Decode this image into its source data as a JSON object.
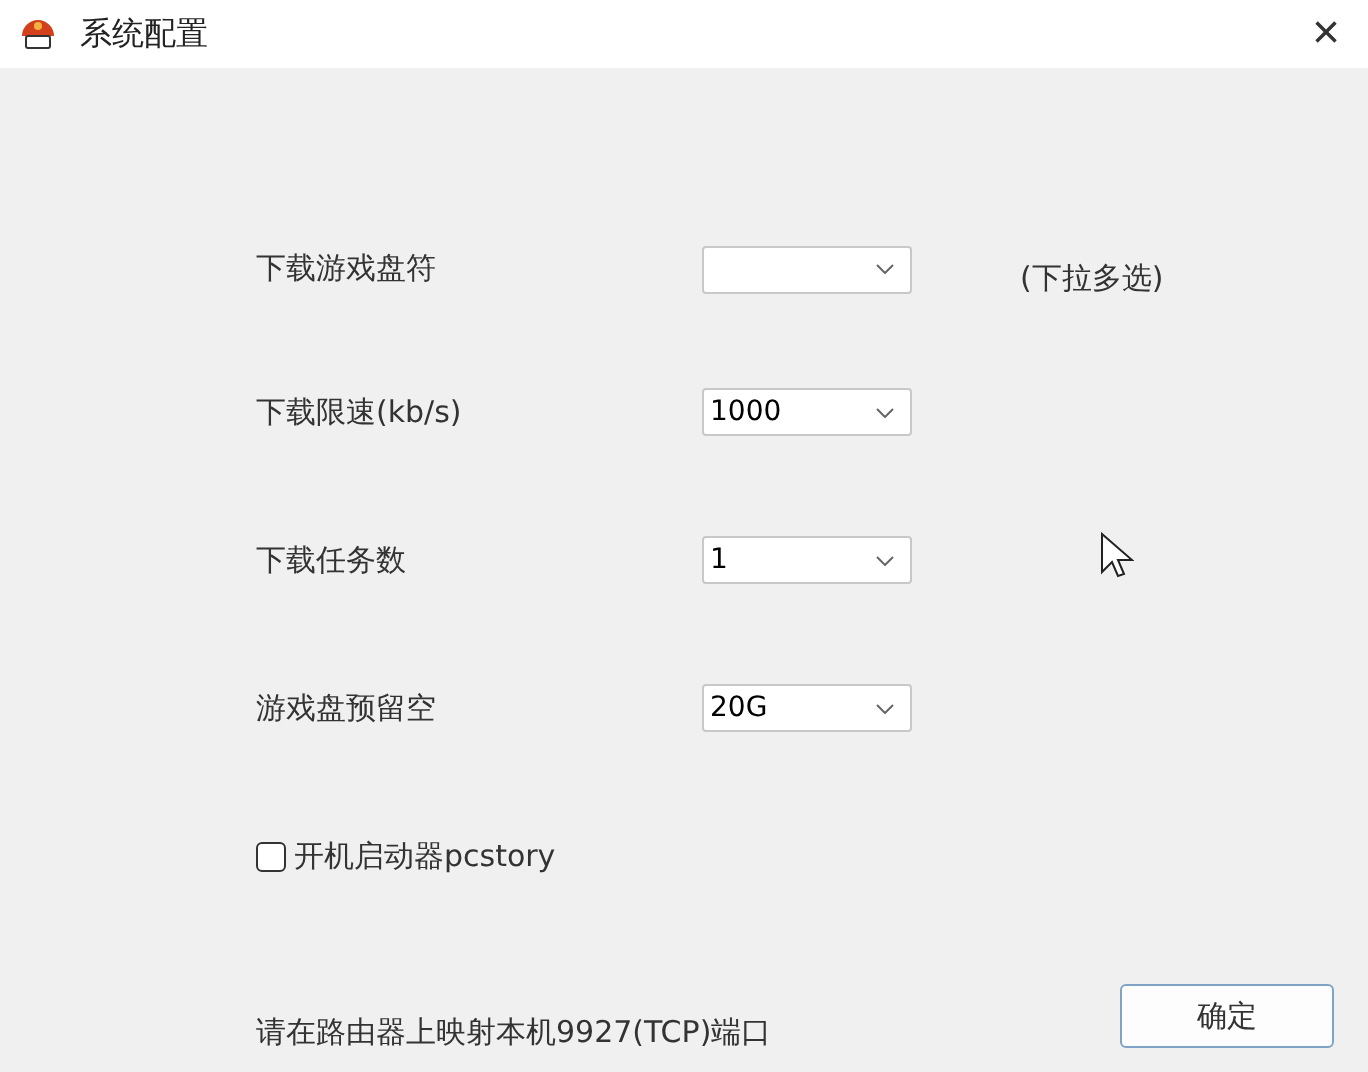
{
  "window": {
    "title": "系统配置",
    "close": "×"
  },
  "fields": [
    {
      "label": "下载游戏盘符",
      "note": "(下拉多选)"
    },
    {
      "label": "下载限速(kb/s)",
      "value": "1000"
    },
    {
      "label": "下载任务数",
      "value": "1"
    },
    {
      "label": "游戏盘预留空",
      "value": "20G"
    }
  ],
  "autostart": {
    "label": "开机启动器pcstory",
    "checked": false
  },
  "footer": {
    "hint": "请在路由器上映射本机9927(TCP)端口",
    "button": "确定"
  }
}
